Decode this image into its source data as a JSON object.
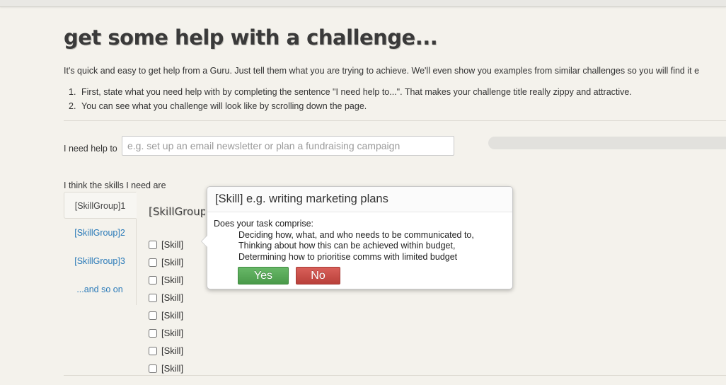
{
  "page": {
    "title": "get some help with a challenge...",
    "intro": "It's quick and easy to get help from a Guru. Just tell them what you are trying to achieve. We'll even show you examples from similar challenges so you will find it e",
    "steps": [
      {
        "num": "1.",
        "text": "First, state what you need help with by completing the sentence \"I need help to...\". That makes your challenge title really zippy and attractive."
      },
      {
        "num": "2.",
        "text": "You can see what you challenge will look like by scrolling down the page."
      }
    ]
  },
  "help": {
    "label": "I need help to",
    "placeholder": "e.g. set up an email newsletter or plan a fundraising campaign"
  },
  "skills": {
    "label": "I think the skills I need are",
    "tabs": [
      "[SkillGroup]1",
      "[SkillGroup]2",
      "[SkillGroup]3",
      "...and so on"
    ],
    "group_title": "[SkillGroup]1",
    "items": [
      "[Skill]",
      "[Skill]",
      "[Skill]",
      "[Skill]",
      "[Skill]",
      "[Skill]",
      "[Skill]",
      "[Skill]"
    ]
  },
  "popover": {
    "title": "[Skill] e.g. writing marketing plans",
    "question": "Does your task comprise:",
    "lines": [
      "Deciding how, what, and who needs to be communicated to,",
      "Thinking about how this can be achieved within budget,",
      "Determining how to prioritise comms with limited budget"
    ],
    "yes_label": "Yes",
    "no_label": "No"
  },
  "colors": {
    "link": "#2a7ab8",
    "yes": "#4a9a4a",
    "no": "#b9403a",
    "background": "#f4f2ec"
  }
}
